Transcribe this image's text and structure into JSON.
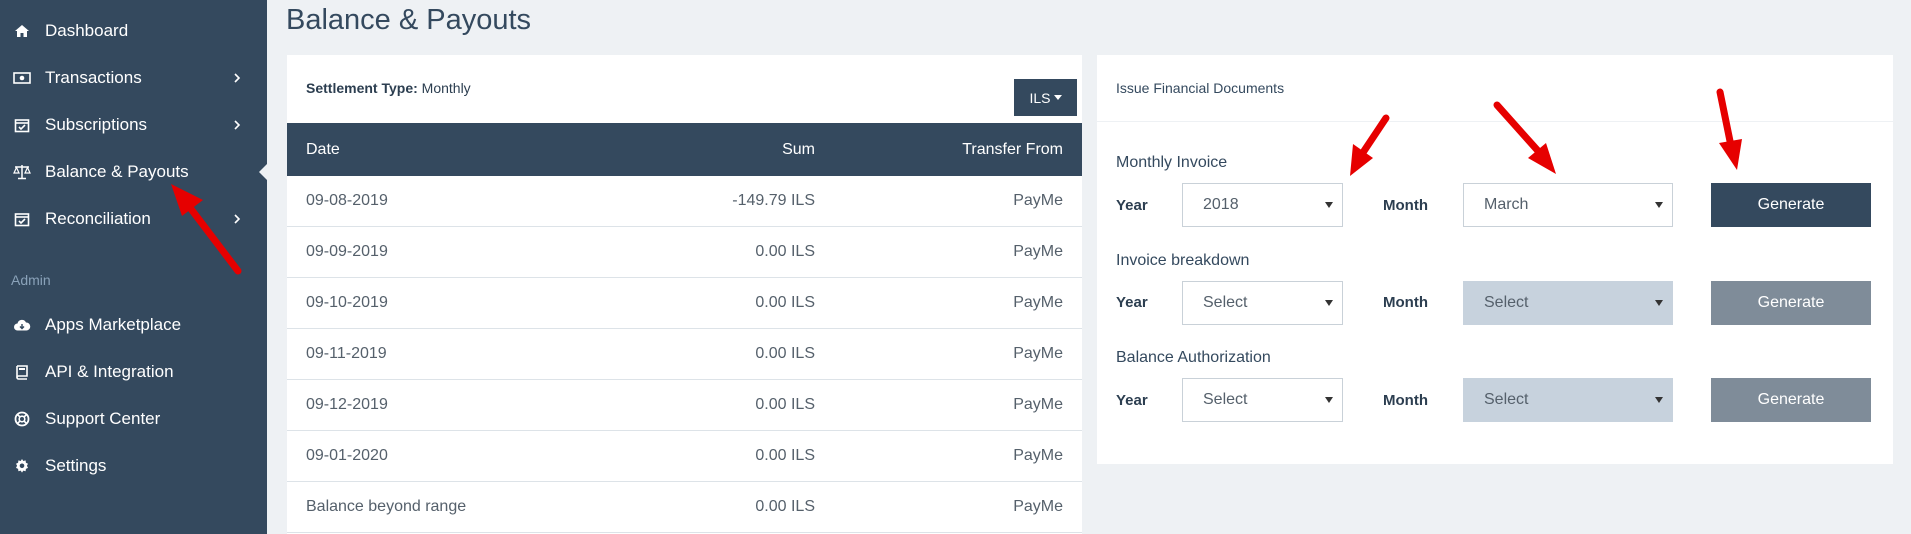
{
  "sidebar": {
    "items": [
      {
        "label": "Dashboard",
        "icon": "home-icon"
      },
      {
        "label": "Transactions",
        "icon": "cash-icon"
      },
      {
        "label": "Subscriptions",
        "icon": "calendar-check-icon"
      },
      {
        "label": "Balance & Payouts",
        "icon": "balance-scale-icon"
      },
      {
        "label": "Reconciliation",
        "icon": "calendar-check-icon"
      }
    ],
    "admin_label": "Admin",
    "admin_items": [
      {
        "label": "Apps Marketplace",
        "icon": "cloud-download-icon"
      },
      {
        "label": "API & Integration",
        "icon": "book-icon"
      },
      {
        "label": "Support Center",
        "icon": "life-ring-icon"
      },
      {
        "label": "Settings",
        "icon": "gear-icon"
      }
    ]
  },
  "page": {
    "title": "Balance & Payouts"
  },
  "settlement": {
    "type_label": "Settlement Type:",
    "type_value": "Monthly",
    "currency": "ILS",
    "columns": {
      "date": "Date",
      "sum": "Sum",
      "from": "Transfer From"
    },
    "rows": [
      {
        "date": "09-08-2019",
        "sum": "-149.79 ILS",
        "from": "PayMe"
      },
      {
        "date": "09-09-2019",
        "sum": "0.00 ILS",
        "from": "PayMe"
      },
      {
        "date": "09-10-2019",
        "sum": "0.00 ILS",
        "from": "PayMe"
      },
      {
        "date": "09-11-2019",
        "sum": "0.00 ILS",
        "from": "PayMe"
      },
      {
        "date": "09-12-2019",
        "sum": "0.00 ILS",
        "from": "PayMe"
      },
      {
        "date": "09-01-2020",
        "sum": "0.00 ILS",
        "from": "PayMe"
      },
      {
        "date": "Balance beyond range",
        "sum": "0.00 ILS",
        "from": "PayMe"
      }
    ]
  },
  "documents": {
    "title": "Issue Financial Documents",
    "year_label": "Year",
    "month_label": "Month",
    "groups": [
      {
        "label": "Monthly Invoice",
        "year": "2018",
        "month": "March",
        "button": "Generate",
        "disabled": false
      },
      {
        "label": "Invoice breakdown",
        "year": "Select",
        "month": "Select",
        "button": "Generate",
        "disabled": true
      },
      {
        "label": "Balance Authorization",
        "year": "Select",
        "month": "Select",
        "button": "Generate",
        "disabled": true
      }
    ]
  },
  "colors": {
    "sidebar": "#34495e",
    "accent": "#34495e",
    "arrow": "#e60000"
  }
}
